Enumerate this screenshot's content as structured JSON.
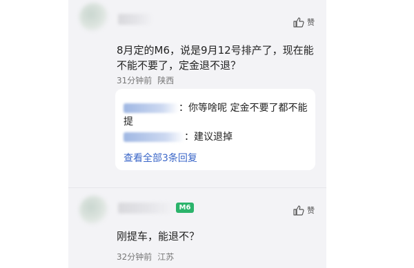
{
  "comments": [
    {
      "text": "8月定的M6，说是9月12号排产了，现在能不能不要了，定金退不退？",
      "time": "31分钟前",
      "location": "陕西",
      "like_label": "赞",
      "replies": [
        {
          "text": "：你等啥呢  定金不要了都不能提"
        },
        {
          "text": "：建议退掉"
        }
      ],
      "view_all": "查看全部3条回复"
    },
    {
      "badge": "M6",
      "text": "刚提车，能退不？",
      "time": "32分钟前",
      "location": "江苏",
      "like_label": "赞"
    }
  ],
  "colors": {
    "panel_bg": "#f3f3f6",
    "link": "#3a66c8",
    "badge": "#2bb36b"
  }
}
